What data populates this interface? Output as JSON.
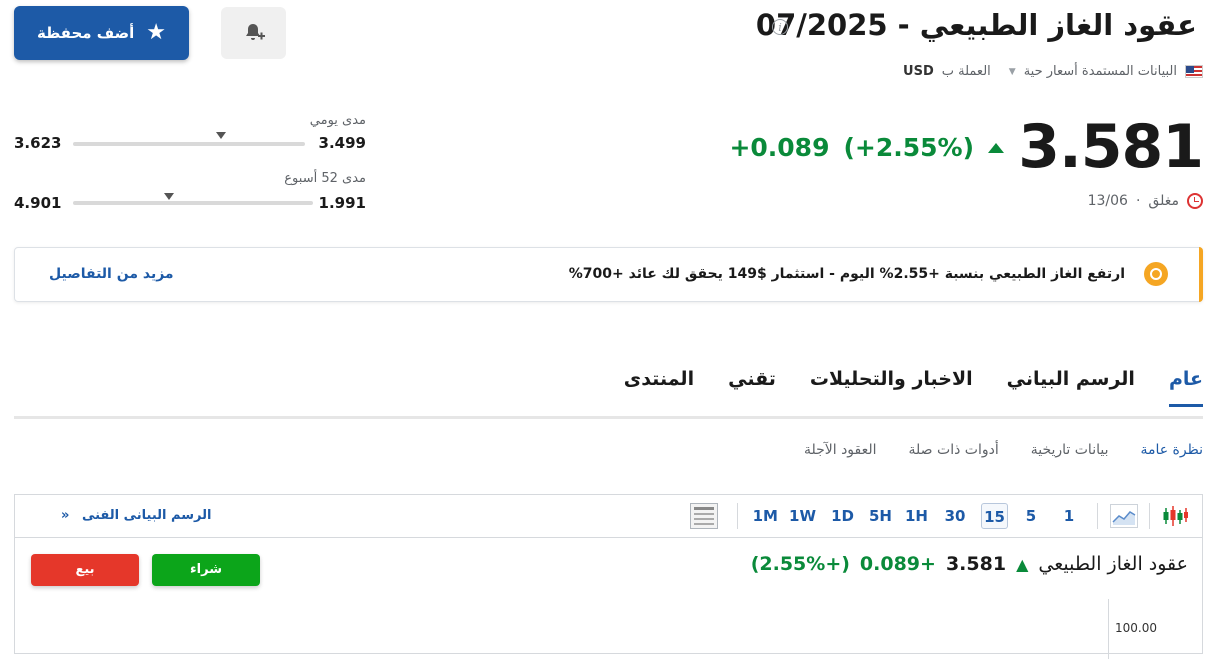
{
  "header": {
    "title": "عقود الغاز الطبيعي - 07/2025",
    "data_source": "البيانات المستمدة أسعار حية",
    "currency_label": "العملة ب",
    "currency": "USD",
    "add_portfolio_label": "أضف محفظة"
  },
  "quote": {
    "price": "3.581",
    "change": "+0.089",
    "change_pct": "(+2.55%)",
    "status": "مغلق",
    "date": "13/06"
  },
  "ranges": {
    "daily": {
      "label": "مدى يومي",
      "low": "3.499",
      "high": "3.623",
      "position": 0.36
    },
    "week52": {
      "label": "مدى 52 أسبوع",
      "low": "1.991",
      "high": "4.901",
      "position": 0.6
    }
  },
  "promo": {
    "text": "ارتفع الغاز الطبيعي بنسبة +2.55% اليوم - استثمار $149 يحقق لك عائد +700%",
    "link": "مزيد من التفاصيل"
  },
  "tabs": [
    "عام",
    "الرسم البياني",
    "الاخبار والتحليلات",
    "تقني",
    "المنتدى"
  ],
  "subtabs": [
    "نظرة عامة",
    "بيانات تاريخية",
    "أدوات ذات صلة",
    "العقود الآجلة"
  ],
  "chart": {
    "timeframes": [
      "1",
      "5",
      "15",
      "30",
      "1H",
      "5H",
      "1D",
      "1W",
      "1M"
    ],
    "active_timeframe": "15",
    "tech_chart_link": "الرسم البيانى الفنى",
    "instrument": "عقود الغاز الطبيعي",
    "price": "3.581",
    "change": "+0.089",
    "change_pct": "(+2.55%)",
    "buy_label": "شراء",
    "sell_label": "بيع",
    "axis_label": "100.00"
  },
  "colors": {
    "accent": "#1d5aa7",
    "up": "#0a8a3a",
    "buy": "#0ca51a",
    "sell": "#e5372a",
    "promo_accent": "#f5a623"
  }
}
